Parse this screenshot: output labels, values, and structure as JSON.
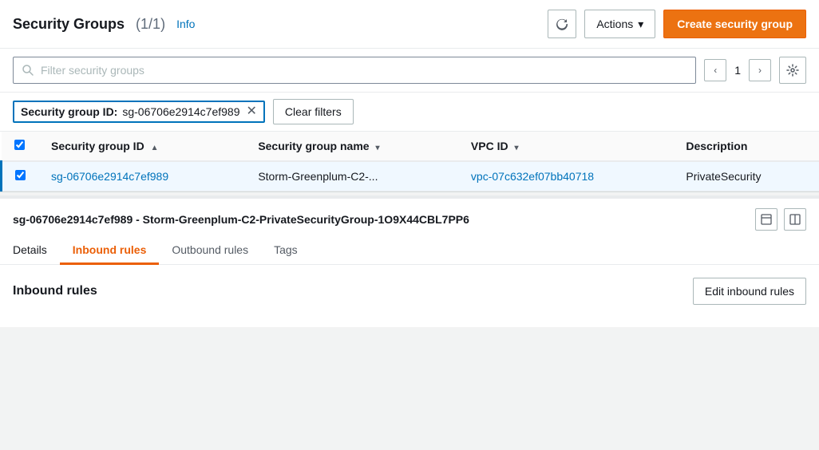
{
  "header": {
    "title": "Security Groups",
    "count": "(1/1)",
    "info_label": "Info",
    "refresh_label": "↻",
    "actions_label": "Actions",
    "create_label": "Create security group"
  },
  "search": {
    "placeholder": "Filter security groups",
    "page_number": "1"
  },
  "filter": {
    "tag_key": "Security group ID:",
    "tag_value": "sg-06706e2914c7ef989",
    "clear_label": "Clear filters"
  },
  "table": {
    "columns": [
      {
        "id": "security_group_id",
        "label": "Security group ID",
        "sort": "asc"
      },
      {
        "id": "security_group_name",
        "label": "Security group name",
        "sort": "desc"
      },
      {
        "id": "vpc_id",
        "label": "VPC ID",
        "sort": "desc"
      },
      {
        "id": "description",
        "label": "Description",
        "sort": "none"
      }
    ],
    "rows": [
      {
        "selected": true,
        "security_group_id": "sg-06706e2914c7ef989",
        "security_group_name": "Storm-Greenplum-C2-...",
        "vpc_id": "vpc-07c632ef07bb40718",
        "description": "PrivateSecurity"
      }
    ]
  },
  "bottom": {
    "title": "sg-06706e2914c7ef989 - Storm-Greenplum-C2-PrivateSecurityGroup-1O9X44CBL7PP6",
    "tabs": [
      {
        "id": "details",
        "label": "Details"
      },
      {
        "id": "inbound_rules",
        "label": "Inbound rules"
      },
      {
        "id": "outbound_rules",
        "label": "Outbound rules"
      },
      {
        "id": "tags",
        "label": "Tags"
      }
    ],
    "inbound": {
      "title": "Inbound rules",
      "edit_label": "Edit inbound rules"
    }
  }
}
